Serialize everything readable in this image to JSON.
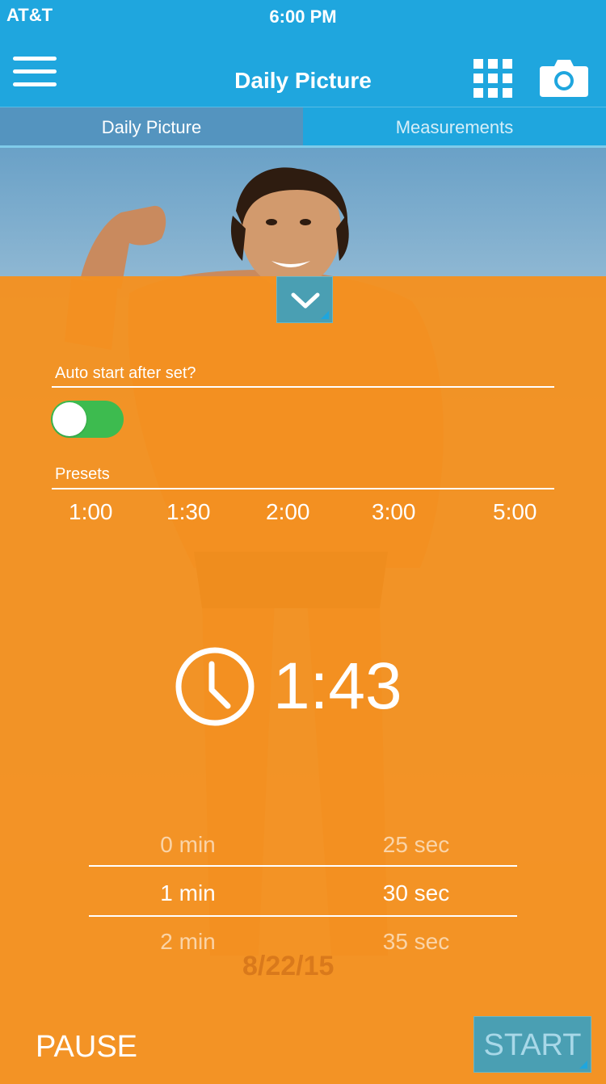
{
  "status_bar": {
    "carrier": "AT&T",
    "time": "6:00 PM"
  },
  "navbar": {
    "title": "Daily Picture",
    "icons": [
      "hamburger-menu-icon",
      "grid-icon",
      "camera-icon"
    ]
  },
  "tabs": [
    {
      "label": "Daily Picture",
      "active": true
    },
    {
      "label": "Measurements",
      "active": false
    }
  ],
  "timer_panel": {
    "auto_start_label": "Auto start after set?",
    "auto_start_enabled": true,
    "presets_label": "Presets",
    "presets": [
      "1:00",
      "1:30",
      "2:00",
      "3:00",
      "5:00"
    ],
    "timer_value": "1:43",
    "picker": {
      "minutes": [
        "0 min",
        "1 min",
        "2 min"
      ],
      "seconds": [
        "25 sec",
        "30 sec",
        "35 sec"
      ],
      "selected_index": 1
    },
    "background_date": "8/22/15",
    "pause_label": "PAUSE",
    "start_label": "START"
  },
  "colors": {
    "header_blue": "#1fa6de",
    "overlay_orange": "#f5911e",
    "toggle_green": "#3dbb4f",
    "button_teal": "#4a9fb3"
  }
}
